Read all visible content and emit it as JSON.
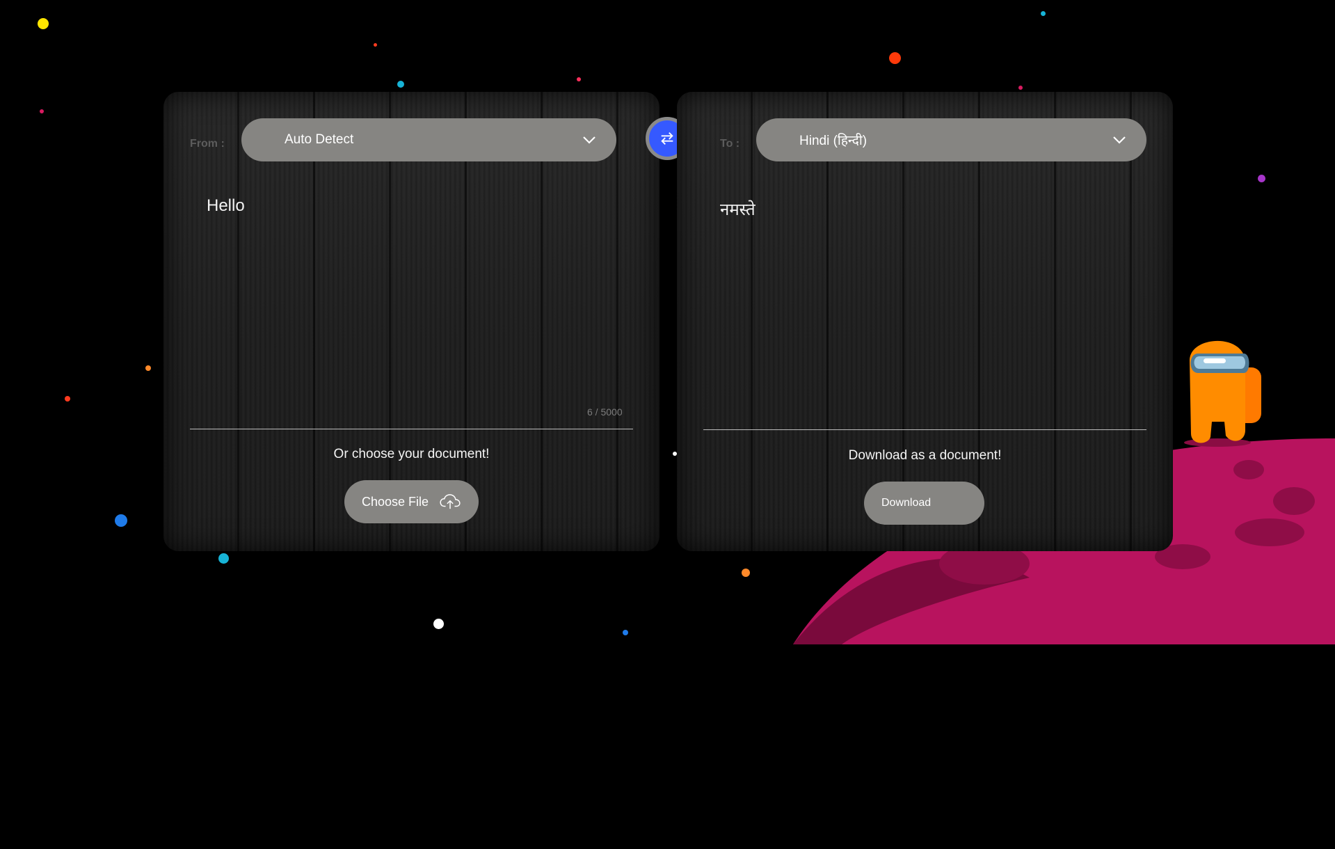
{
  "source": {
    "label": "From :",
    "language": "Auto Detect",
    "text": "Hello",
    "counter": "6 / 5000",
    "upload_caption": "Or choose your document!",
    "choose_file_label": "Choose File"
  },
  "target": {
    "label": "To :",
    "language": "Hindi (हिन्दी)",
    "text": "नमस्ते",
    "download_caption": "Download as a document!",
    "download_label": "Download"
  },
  "colors": {
    "swap_button": "#3559ff",
    "pill": "#868582",
    "planet": "#b8135e",
    "crewmate": "#ff8a00"
  },
  "icons": {
    "swap": "swap-arrows-icon",
    "chevron": "chevron-down-icon",
    "upload": "cloud-upload-icon"
  }
}
